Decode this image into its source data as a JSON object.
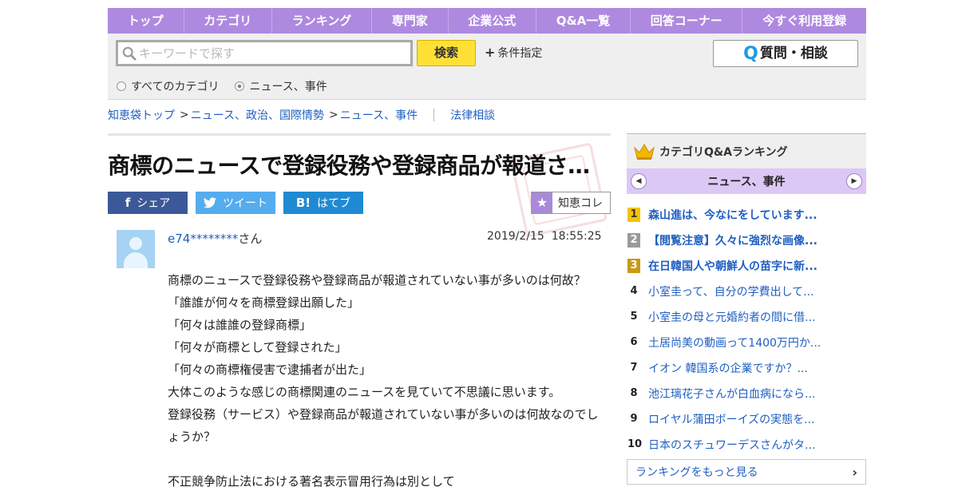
{
  "nav": {
    "items": [
      "トップ",
      "カテゴリ",
      "ランキング",
      "専門家",
      "企業公式",
      "Q&A一覧",
      "回答コーナー",
      "今すぐ利用登録"
    ]
  },
  "search": {
    "placeholder": "キーワードで探す",
    "button_label": "検索",
    "conditions_label": "条件指定",
    "ask_button_label": "質問・相談",
    "ask_button_icon": "Q",
    "scope_all": "すべてのカテゴリ",
    "scope_current": "ニュース、事件"
  },
  "breadcrumb": {
    "top": "知恵袋トップ",
    "level1": "ニュース、政治、国際情勢",
    "level2": "ニュース、事件",
    "extra": "法律相談",
    "separator": ">"
  },
  "question": {
    "title": "商標のニュースで登録役務や登録商品が報道されていない事が多いのは何故？",
    "user_id": "e74********",
    "user_suffix": "さん",
    "date": "2019/2/15",
    "time": "18:55:25",
    "body": [
      "商標のニュースで登録役務や登録商品が報道されていない事が多いのは何故？",
      "「誰誰が何々を商標登録出願した」",
      "「何々は誰誰の登録商標」",
      "「何々が商標として登録された」",
      "「何々の商標権侵害で逮捕者が出た」",
      "大体このような感じの商標関連のニュースを見ていて不思議に思います。",
      "登録役務（サービス）や登録商品が報道されていない事が多いのは何故なのでしょうか？",
      "",
      "不正競争防止法における著名表示冒用行為は別として"
    ]
  },
  "share": {
    "facebook": "シェア",
    "facebook_icon": "f",
    "twitter": "ツイート",
    "hatena": "はてブ",
    "hatena_icon": "B!",
    "chiekore": "知恵コレ"
  },
  "sidebar": {
    "heading": "カテゴリQ&Aランキング",
    "category": "ニュース、事件",
    "ranking": [
      {
        "rank": "1",
        "title": "森山進は、今なにをしています..."
      },
      {
        "rank": "2",
        "title": "【閲覧注意】久々に強烈な画像..."
      },
      {
        "rank": "3",
        "title": "在日韓国人や朝鮮人の苗字に新..."
      },
      {
        "rank": "4",
        "title": "小室圭って、自分の学費出して..."
      },
      {
        "rank": "5",
        "title": "小室圭の母と元婚約者の間に借..."
      },
      {
        "rank": "6",
        "title": "土居尚美の動画って1400万円か..."
      },
      {
        "rank": "7",
        "title": "イオン 韓国系の企業ですか？..."
      },
      {
        "rank": "8",
        "title": "池江璃花子さんが白血病になら..."
      },
      {
        "rank": "9",
        "title": "ロイヤル蒲田ボーイズの実態を..."
      },
      {
        "rank": "10",
        "title": "日本のスチュワーデスさんがタ..."
      }
    ],
    "more_label": "ランキングをもっと見る"
  },
  "colors": {
    "nav_bg": "#ae89e0",
    "search_button": "#ffe135",
    "link": "#1f5fc2",
    "facebook": "#3b5998",
    "twitter": "#55acee",
    "hatena": "#1f8ad2",
    "category_bar": "#dcc8f5"
  },
  "icons": [
    "search-icon",
    "plus-icon",
    "q-icon",
    "facebook-icon",
    "twitter-bird-icon",
    "hatena-icon",
    "star-icon",
    "crown-icon",
    "chevron-left-icon",
    "chevron-right-icon",
    "user-silhouette-icon"
  ]
}
